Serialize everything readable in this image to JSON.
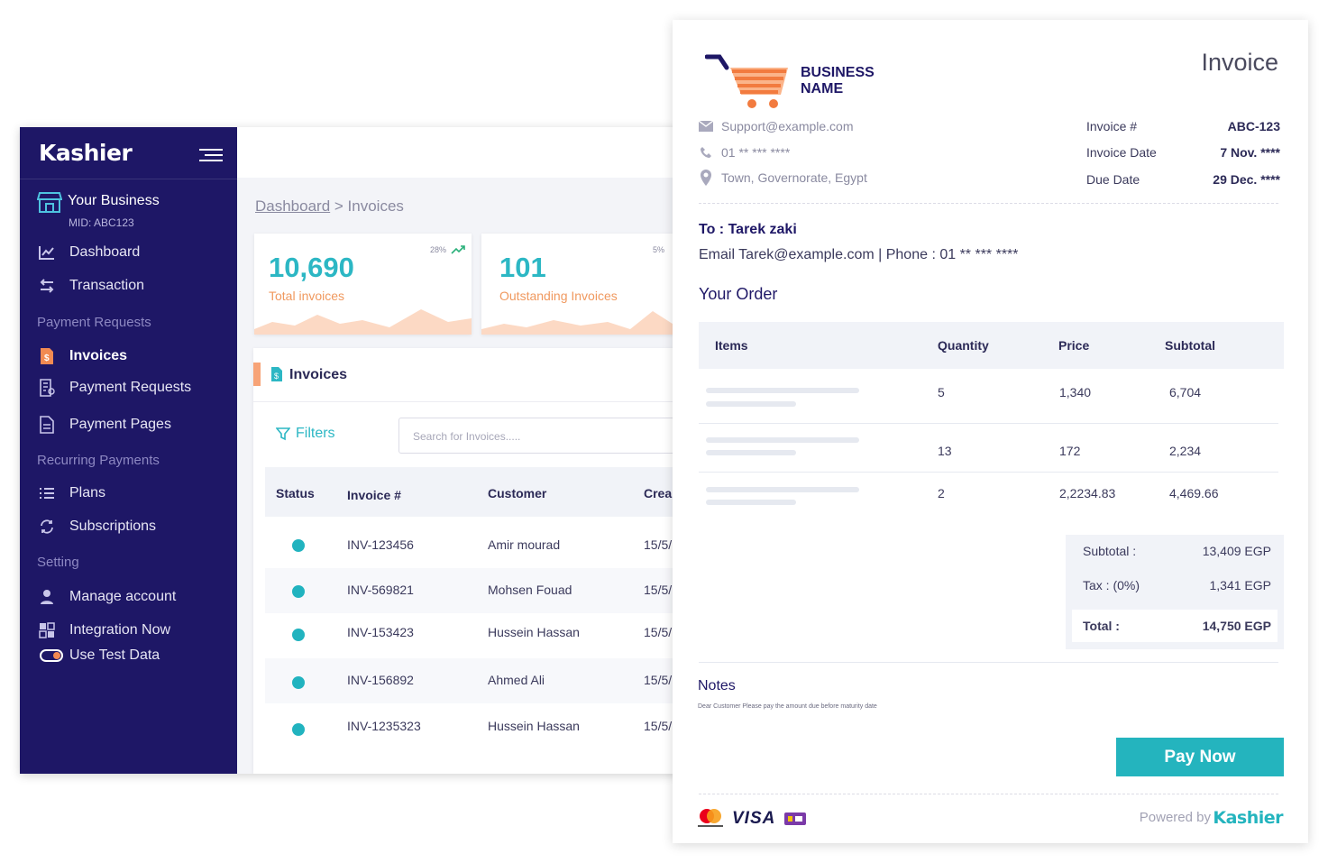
{
  "dashboard": {
    "brand": "Kashier",
    "business": {
      "name": "Your Business",
      "mid": "MID: ABC123"
    },
    "nav": [
      {
        "label": "Dashboard",
        "icon": "chart-icon"
      },
      {
        "label": "Transaction",
        "icon": "transfer-icon"
      },
      {
        "label": "Invoices",
        "icon": "invoice-icon",
        "active": true
      },
      {
        "label": "Payment Requests",
        "icon": "receipt-icon"
      },
      {
        "label": "Payment Pages",
        "icon": "page-icon"
      },
      {
        "label": "Plans",
        "icon": "list-icon"
      },
      {
        "label": "Subscriptions",
        "icon": "refresh-icon"
      },
      {
        "label": "Manage account",
        "icon": "user-icon"
      },
      {
        "label": "Integration Now",
        "icon": "puzzle-icon"
      },
      {
        "label": "Use Test Data",
        "icon": "toggle-icon"
      }
    ],
    "sections": [
      "Payment Requests",
      "Recurring Payments",
      "Setting"
    ],
    "breadcrumb": {
      "root": "Dashboard",
      "sep": " > ",
      "current": "Invoices"
    },
    "stats": [
      {
        "value": "10,690",
        "label": "Total invoices",
        "change": "28%"
      },
      {
        "value": "101",
        "label": "Outstanding Invoices",
        "change": "5%"
      }
    ],
    "panel": {
      "title": "Invoices",
      "filters_label": "Filters",
      "search_placeholder": "Search for Invoices.....",
      "columns": [
        "Status",
        "Invoice #",
        "Customer",
        "Crea"
      ],
      "rows": [
        {
          "invoice": "INV-123456",
          "customer": "Amir  mourad",
          "created": "15/5/"
        },
        {
          "invoice": "INV-569821",
          "customer": "Mohsen Fouad",
          "created": "15/5/"
        },
        {
          "invoice": "INV-153423",
          "customer": "Hussein Hassan",
          "created": "15/5/"
        },
        {
          "invoice": "INV-156892",
          "customer": "Ahmed Ali",
          "created": "15/5/"
        },
        {
          "invoice": "INV-1235323",
          "customer": "Hussein Hassan",
          "created": "15/5/"
        }
      ]
    }
  },
  "invoice": {
    "business_name_line1": "BUSINESS",
    "business_name_line2": "NAME",
    "title": "Invoice",
    "email": "Support@example.com",
    "phone": "01 ** *** ****",
    "address": "Town, Governorate, Egypt",
    "meta": [
      {
        "label": "Invoice #",
        "value": "ABC-123"
      },
      {
        "label": "Invoice Date",
        "value": "7 Nov. ****"
      },
      {
        "label": "Due Date",
        "value": "29 Dec. ****"
      }
    ],
    "to": "To : Tarek zaki",
    "email_line": "Email  Tarek@example.com   |   Phone : 01 ** *** ****",
    "your_order": "Your Order",
    "columns": [
      "Items",
      "Quantity",
      "Price",
      "Subtotal"
    ],
    "items": [
      {
        "qty": "5",
        "price": "1,340",
        "subtotal": "6,704"
      },
      {
        "qty": "13",
        "price": "172",
        "subtotal": "2,234"
      },
      {
        "qty": "2",
        "price": "2,2234.83",
        "subtotal": "4,469.66"
      }
    ],
    "totals": {
      "subtotal_label": "Subtotal :",
      "subtotal_value": "13,409  EGP",
      "tax_label": "Tax :    (0%)",
      "tax_value": "1,341 EGP",
      "total_label": "Total :",
      "total_value": "14,750  EGP"
    },
    "notes_title": "Notes",
    "notes_text": "Dear Customer Please pay the amount due before maturity date",
    "pay_button": "Pay Now",
    "card_brand": "VISA",
    "powered_by": "Powered by",
    "powered_brand": "Kashier"
  },
  "colors": {
    "sidebar": "#1e1766",
    "accent": "#24b4be",
    "orange": "#f28a52"
  }
}
